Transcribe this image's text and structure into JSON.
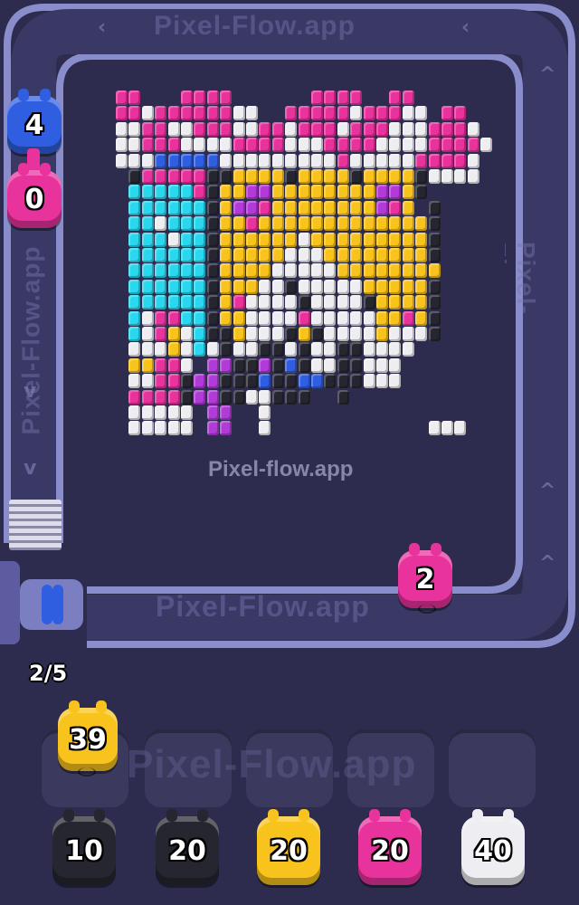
{
  "watermark": "Pixel-flow.app",
  "watermark_track_top": "Pixel-Flow.app",
  "watermark_track_bottom": "Pixel-Flow.app",
  "watermark_track_right": "Pixel-Flow.app",
  "watermark_track_left": "Pixel-Flow.app",
  "watermark_slots": "Pixel-Flow.app",
  "queue_counter": "2/5",
  "track_pigs": [
    {
      "color": "blue",
      "value": "4"
    },
    {
      "color": "pink",
      "value": "0"
    },
    {
      "color": "pink",
      "value": "2"
    }
  ],
  "slot_pigs": [
    {
      "color": "yellow",
      "value": "39"
    }
  ],
  "waiting_pigs": [
    {
      "color": "black",
      "value": "10"
    },
    {
      "color": "black",
      "value": "20"
    },
    {
      "color": "yellow",
      "value": "20"
    },
    {
      "color": "pink",
      "value": "20"
    },
    {
      "color": "white",
      "value": "40"
    }
  ],
  "colors": {
    "pink": "#e8329c",
    "blue": "#2f5fe0",
    "yellow": "#f8c31c",
    "black": "#262630",
    "white": "#eeeef2",
    "cyan": "#2ad7ee",
    "purple": "#b23ad8",
    "track": "#7d80c0",
    "background": "#2d2c4e"
  }
}
